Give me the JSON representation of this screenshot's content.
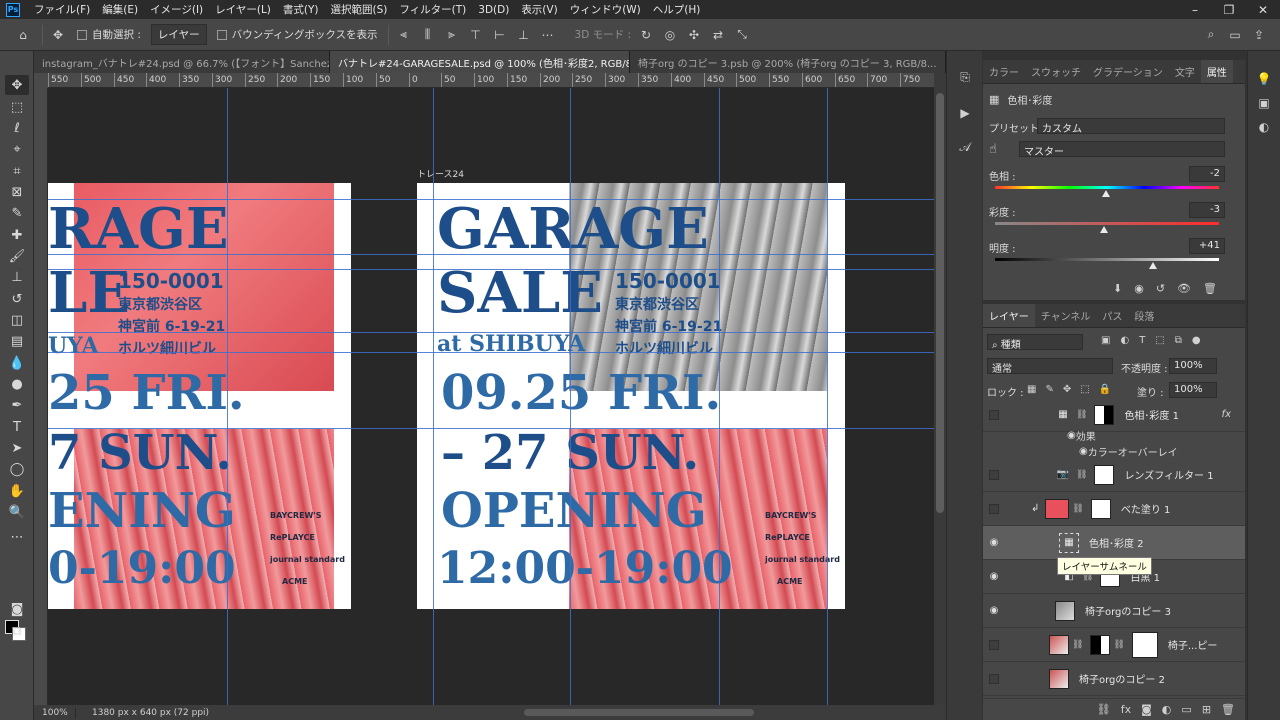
{
  "menu": [
    "ファイル(F)",
    "編集(E)",
    "イメージ(I)",
    "レイヤー(L)",
    "書式(Y)",
    "選択範囲(S)",
    "フィルター(T)",
    "3D(D)",
    "表示(V)",
    "ウィンドウ(W)",
    "ヘルプ(H)"
  ],
  "options": {
    "auto_select_label": "自動選択 :",
    "auto_select_value": "レイヤー",
    "bbox_label": "バウンディングボックスを表示",
    "mode3d_label": "3D モード :"
  },
  "tabs": [
    "instagram_バナトレ#24.psd @ 66.7% (【フォント】Sanchez /...",
    "バナトレ#24-GARAGESALE.psd @ 100% (色相･彩度2, RGB/8#) *",
    "椅子org のコピー 3.psb @ 200% (椅子org のコピー 3, RGB/8..."
  ],
  "ruler_ticks": [
    "550",
    "500",
    "450",
    "400",
    "350",
    "300",
    "250",
    "200",
    "150",
    "100",
    "50",
    "0",
    "50",
    "100",
    "150",
    "200",
    "250",
    "300",
    "350",
    "400",
    "450",
    "500",
    "550",
    "600",
    "650",
    "700",
    "750"
  ],
  "poster": {
    "artboard_label": "トレース24",
    "title1": "GARAGE",
    "title2": "SALE",
    "at": "at SHIBUYA",
    "zip": "150-0001",
    "addr1": "東京都渋谷区",
    "addr2": "神宮前 6-19-21",
    "addr3": "ホルツ細川ビル",
    "date1": "09.25 FRI.",
    "date2": "– 27 SUN.",
    "opening": "OPENING",
    "time": "12:00-19:00",
    "left_title1": "RAGE",
    "left_title2": "LE",
    "left_at": "UYA",
    "left_date1": "25 FRI.",
    "left_date2": "7 SUN.",
    "left_opening": "ENING",
    "left_time": "0-19:00",
    "logos": [
      "BAYCREW'S",
      "RePLAYCE",
      "journal standard",
      "ACME"
    ]
  },
  "status": {
    "zoom": "100%",
    "doc": "1380 px x 640 px (72 ppi)"
  },
  "props": {
    "tabs": [
      "カラー",
      "スウォッチ",
      "グラデーション",
      "文字",
      "属性"
    ],
    "header": "色相･彩度",
    "preset_label": "プリセット :",
    "preset_value": "カスタム",
    "channel_value": "マスター",
    "hue_label": "色相 :",
    "hue_value": "-2",
    "sat_label": "彩度 :",
    "sat_value": "-3",
    "light_label": "明度 :",
    "light_value": "+41"
  },
  "layers_panel": {
    "tabs": [
      "レイヤー",
      "チャンネル",
      "パス",
      "段落"
    ],
    "filter": "種類",
    "blend": "通常",
    "opacity_label": "不透明度 :",
    "opacity": "100%",
    "lock_label": "ロック :",
    "fill_label": "塗り :",
    "fill": "100%",
    "effects_label": "効果",
    "effect_name": "カラーオーバーレイ",
    "tooltip": "レイヤーサムネール",
    "layers": [
      {
        "name": "色相･彩度 1"
      },
      {
        "name": "レンズフィルター 1"
      },
      {
        "name": "べた塗り 1"
      },
      {
        "name": "色相･彩度 2"
      },
      {
        "name": "白黒 1"
      },
      {
        "name": "椅子orgのコピー 3"
      },
      {
        "name": "椅子...ピー"
      },
      {
        "name": "椅子orgのコピー 2"
      }
    ]
  },
  "colors": {
    "accent_blue": "#1e4e8a",
    "fill_red": "#e8515b"
  }
}
